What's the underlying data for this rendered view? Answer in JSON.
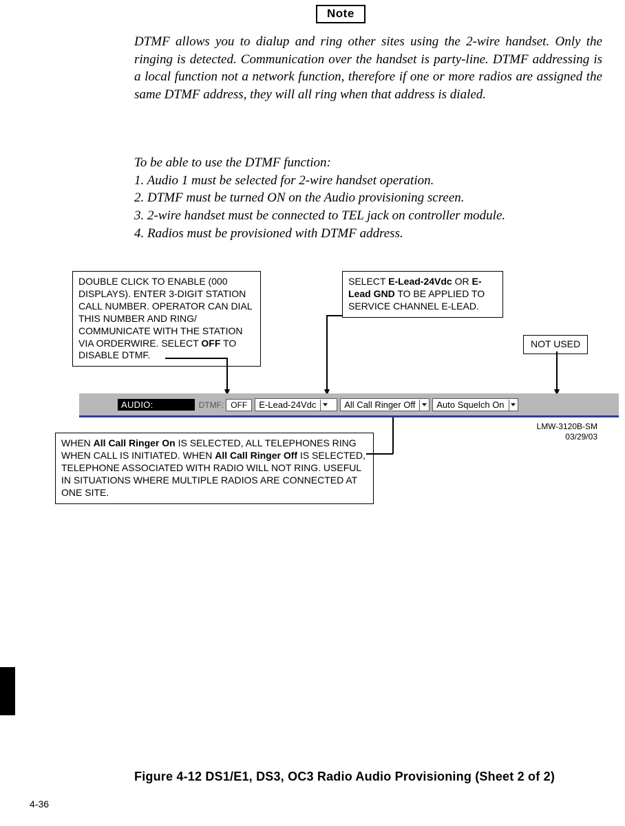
{
  "note_label": "Note",
  "intro_text": "DTMF allows you to dialup and ring other sites using the 2-wire hand­set. Only the ringing is detected. Communication over the handset is party-line. DTMF addressing is a local function not a network func­tion, therefore if one or more radios are assigned the same DTMF address, they will all ring when that address is dialed.",
  "steps_intro": "To be able to use the DTMF function:",
  "steps": [
    "1. Audio 1 must be selected for 2-wire handset operation.",
    "2. DTMF must be turned ON on the Audio provisioning screen.",
    "3. 2-wire handset must be connected to TEL jack on controller module.",
    "4. Radios must be provisioned with DTMF address."
  ],
  "callouts": {
    "dtmf": {
      "pre": "DOUBLE CLICK TO ENABLE (000 DISPLAYS). ENTER 3-DIGIT STATION CALL NUMBER. OPERATOR CAN DIAL THIS NUMBER AND RING/ COMMUNICATE WITH THE STATION VIA ORDERWIRE. SELECT ",
      "bold": "OFF",
      "post": " TO DISABLE DTMF."
    },
    "elead": {
      "pre": "SELECT ",
      "b1": "E-Lead-24Vdc",
      "mid": " OR ",
      "b2": "E-Lead GND",
      "post": " TO BE APPLIED TO SERVICE CHANNEL E-LEAD."
    },
    "notused": "NOT USED",
    "ringer": {
      "pre": "WHEN ",
      "b1": "All Call Ringer On",
      "mid1": " IS SELECTED, ALL TELEPHONES RING WHEN CALL IS INITIATED. WHEN ",
      "b2": "All Call Ringer Off",
      "mid2": " IS SELECTED, TELEPHONE ASSOCIATED WITH RADIO WILL NOT RING. USEFUL IN SITUATIONS WHERE MULTIPLE RADIOS ARE CONNECTED AT ONE SITE."
    }
  },
  "toolbar": {
    "audio_label": "AUDIO:",
    "dtmf_label": "DTMF:",
    "dtmf_value": "OFF",
    "elead_value": "E-Lead-24Vdc",
    "ringer_value": "All Call Ringer Off",
    "squelch_value": "Auto Squelch On"
  },
  "lmw": {
    "line1": "LMW-3120B-SM",
    "line2": "03/29/03"
  },
  "figure_caption": "Figure 4-12  DS1/E1, DS3, OC3 Radio Audio Provisioning (Sheet 2 of 2)",
  "page_number": "4-36"
}
